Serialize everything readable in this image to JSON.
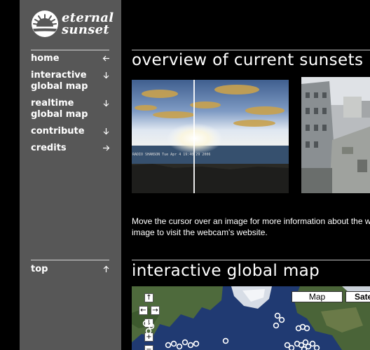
{
  "logo": {
    "line1": "eternal",
    "line2": "sunset",
    "mark_icon": "sunset-icon"
  },
  "nav": {
    "items": [
      {
        "label": "home",
        "icon": "arrow-left-icon"
      },
      {
        "label": "interactive global map",
        "icon": "arrow-down-icon"
      },
      {
        "label": "realtime global map",
        "icon": "arrow-down-icon"
      },
      {
        "label": "contribute",
        "icon": "arrow-down-icon"
      },
      {
        "label": "credits",
        "icon": "arrow-right-icon"
      }
    ],
    "top_label": "top",
    "top_icon": "arrow-up-icon"
  },
  "sections": {
    "overview": {
      "title": "overview of current sunsets",
      "cam1_stamp": "RADIO SHANSON  Tue Apr 4 19:40:29 2006",
      "hint_line1": "Move the cursor over an image for more information about the w",
      "hint_line2": "image to visit the webcam's website."
    },
    "map": {
      "title": "interactive global map",
      "btn_map": "Map",
      "btn_sat": "Sate"
    }
  },
  "colors": {
    "background": "#000000",
    "sidebar": "#575757",
    "rule": "#c8c8c8",
    "ocean": "#223c74"
  }
}
